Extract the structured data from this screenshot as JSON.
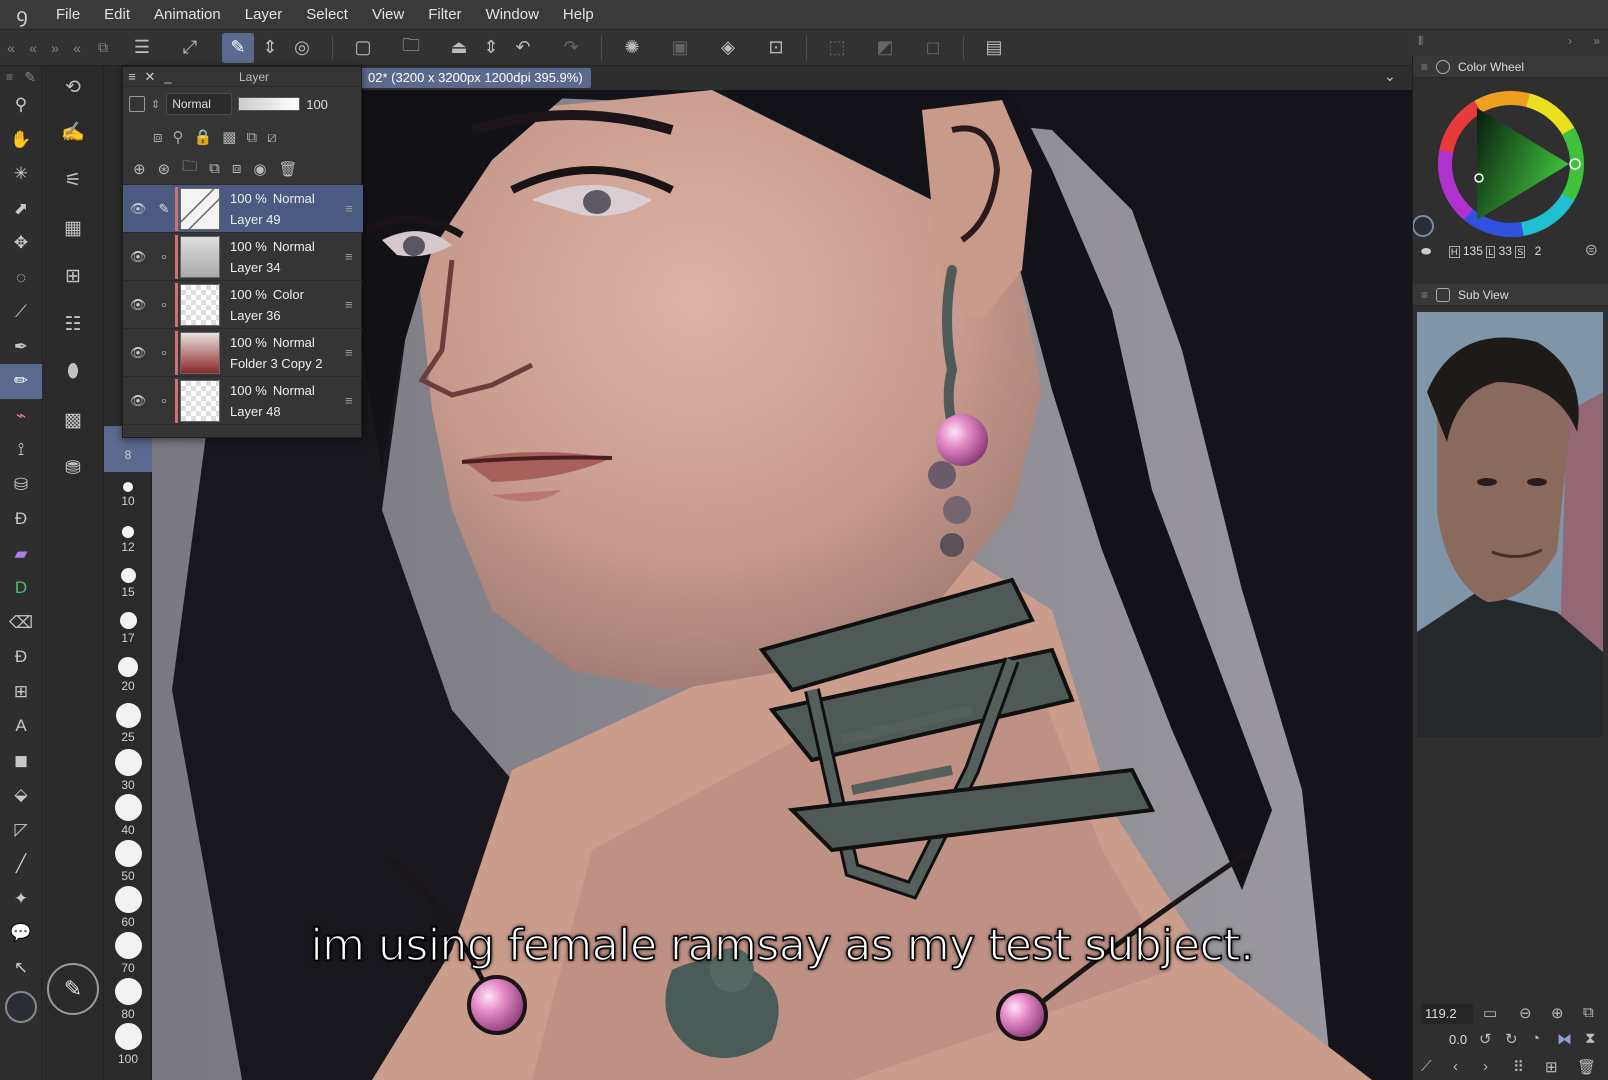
{
  "menu": [
    "File",
    "Edit",
    "Animation",
    "Layer",
    "Select",
    "View",
    "Filter",
    "Window",
    "Help"
  ],
  "canvas": {
    "title": "02* (3200 x 3200px 1200dpi 395.9%)",
    "subtitle": "im using female ramsay as my test subject."
  },
  "layer_panel": {
    "title": "Layer",
    "blend_mode": "Normal",
    "opacity": "100",
    "layers": [
      {
        "opacity": "100 %",
        "mode": "Normal",
        "name": "Layer 49",
        "selected": true
      },
      {
        "opacity": "100 %",
        "mode": "Normal",
        "name": "Layer 34",
        "selected": false
      },
      {
        "opacity": "100 %",
        "mode": "Color",
        "name": "Layer 36",
        "selected": false
      },
      {
        "opacity": "100 %",
        "mode": "Normal",
        "name": "Folder 3 Copy 2",
        "selected": false
      },
      {
        "opacity": "100 %",
        "mode": "Normal",
        "name": "Layer 48",
        "selected": false
      }
    ]
  },
  "brush_sizes": [
    "8",
    "10",
    "12",
    "15",
    "17",
    "20",
    "25",
    "30",
    "40",
    "50",
    "60",
    "70",
    "80",
    "100"
  ],
  "color_wheel": {
    "title": "Color Wheel",
    "h_label": "H",
    "h": "135",
    "l_label": "L",
    "l": "33",
    "s_label": "S",
    "s": "2"
  },
  "sub_view": {
    "title": "Sub View"
  },
  "navigator": {
    "zoom": "119.2",
    "rotation": "0.0"
  }
}
